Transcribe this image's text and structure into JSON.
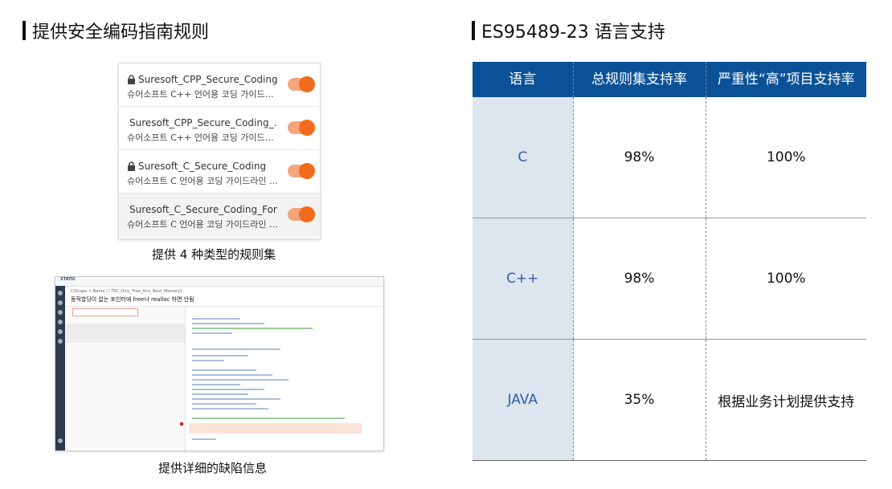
{
  "left_section": {
    "title": "提供安全编码指南规则",
    "rules": [
      {
        "name": "Suresoft_CPP_Secure_Coding",
        "desc": "슈어소프트 C++ 언어용 코딩 가이드라…",
        "enabled": true
      },
      {
        "name": "Suresoft_CPP_Secure_Coding_…",
        "desc": "슈어소프트 C++ 언어용 코딩 가이드라…",
        "enabled": true
      },
      {
        "name": "Suresoft_C_Secure_Coding",
        "desc": "슈어소프트 C 언어용 코딩 가이드라인 …",
        "enabled": true
      },
      {
        "name": "Suresoft_C_Secure_Coding_For…",
        "desc": "슈어소프트 C 언어용 코딩 가이드라인 …",
        "enabled": true
      }
    ],
    "caption_rules": "提供 4 种类型的规则集",
    "caption_defects": "提供详细的缺陷信息",
    "screenshot": {
      "logo": "STATIC",
      "breadcrumb": "C/Scope > Name ☐ TSC_Only_Free_Ons_Next_Memory1",
      "title": "동적할당이 없는 포인터에 free나 realloc 하면 안됨"
    }
  },
  "right_section": {
    "title": "ES95489-23 语言支持",
    "table": {
      "headers": [
        "语言",
        "总规则集支持率",
        "严重性“高”项目支持率"
      ],
      "rows": [
        {
          "lang": "C",
          "total": "98%",
          "high": "100%"
        },
        {
          "lang": "C++",
          "total": "98%",
          "high": "100%"
        },
        {
          "lang": "JAVA",
          "total": "35%",
          "high": "根据业务计划提供支持"
        }
      ]
    }
  },
  "colors": {
    "table_header": "#0b5197",
    "lang_cell": "#dde5ef",
    "toggle_on": "#f26b1d"
  }
}
